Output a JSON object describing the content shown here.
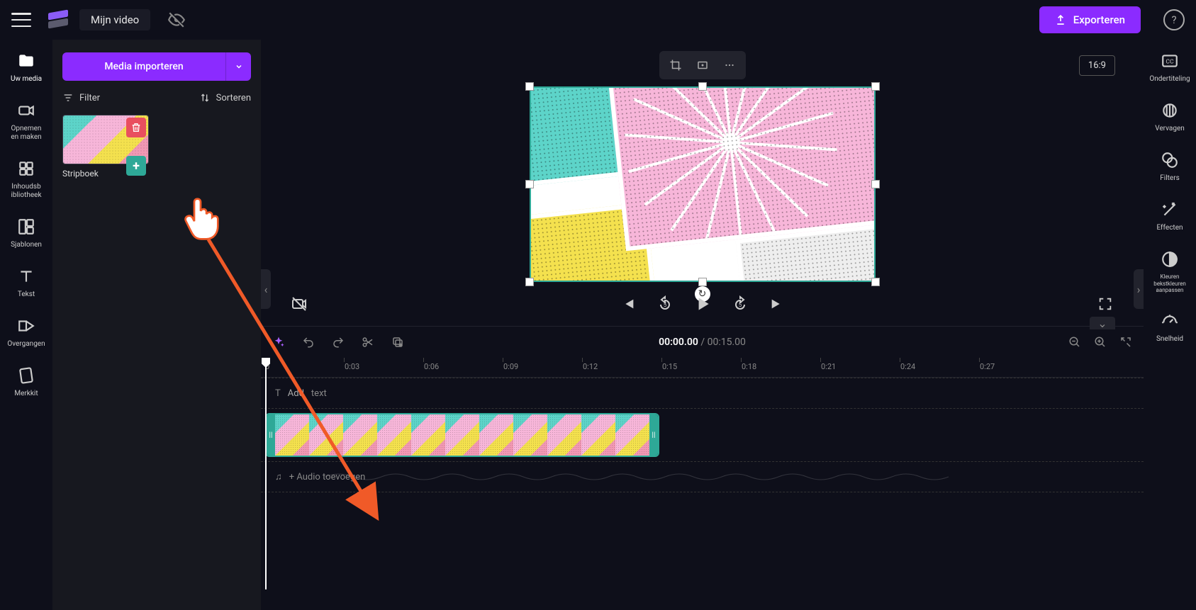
{
  "project_title": "Mijn video",
  "export_label": "Exporteren",
  "aspect_ratio": "16:9",
  "left_rail": [
    {
      "id": "media",
      "label": "Uw media"
    },
    {
      "id": "record",
      "label": "Opnemen\nen maken"
    },
    {
      "id": "library",
      "label": "Inhoudsb\nibliotheek"
    },
    {
      "id": "templates",
      "label": "Sjablonen"
    },
    {
      "id": "text",
      "label": "Tekst"
    },
    {
      "id": "transitions",
      "label": "Overgangen"
    },
    {
      "id": "brandkit",
      "label": "Merkkit"
    }
  ],
  "right_rail": [
    {
      "id": "cc",
      "label": "Ondertiteling"
    },
    {
      "id": "blur",
      "label": "Vervagen"
    },
    {
      "id": "filters",
      "label": "Filters"
    },
    {
      "id": "effects",
      "label": "Effecten"
    },
    {
      "id": "colors",
      "label": "Kleuren bekstkleuren\naanpassen"
    },
    {
      "id": "speed",
      "label": "Snelheid"
    }
  ],
  "media_panel": {
    "import_label": "Media importeren",
    "filter_label": "Filter",
    "sort_label": "Sorteren",
    "items": [
      {
        "name": "Stripboek"
      }
    ]
  },
  "timeline": {
    "current_time": "00:00.00",
    "total_time": "00:15.00",
    "ruler": [
      "0",
      "0:03",
      "0:06",
      "0:09",
      "0:12",
      "0:15",
      "0:18",
      "0:21",
      "0:24",
      "0:27"
    ],
    "text_track_prefix": "T",
    "text_track_add": "Add",
    "text_track_label": "text",
    "audio_track_label": "+ Audio toevoegen"
  }
}
